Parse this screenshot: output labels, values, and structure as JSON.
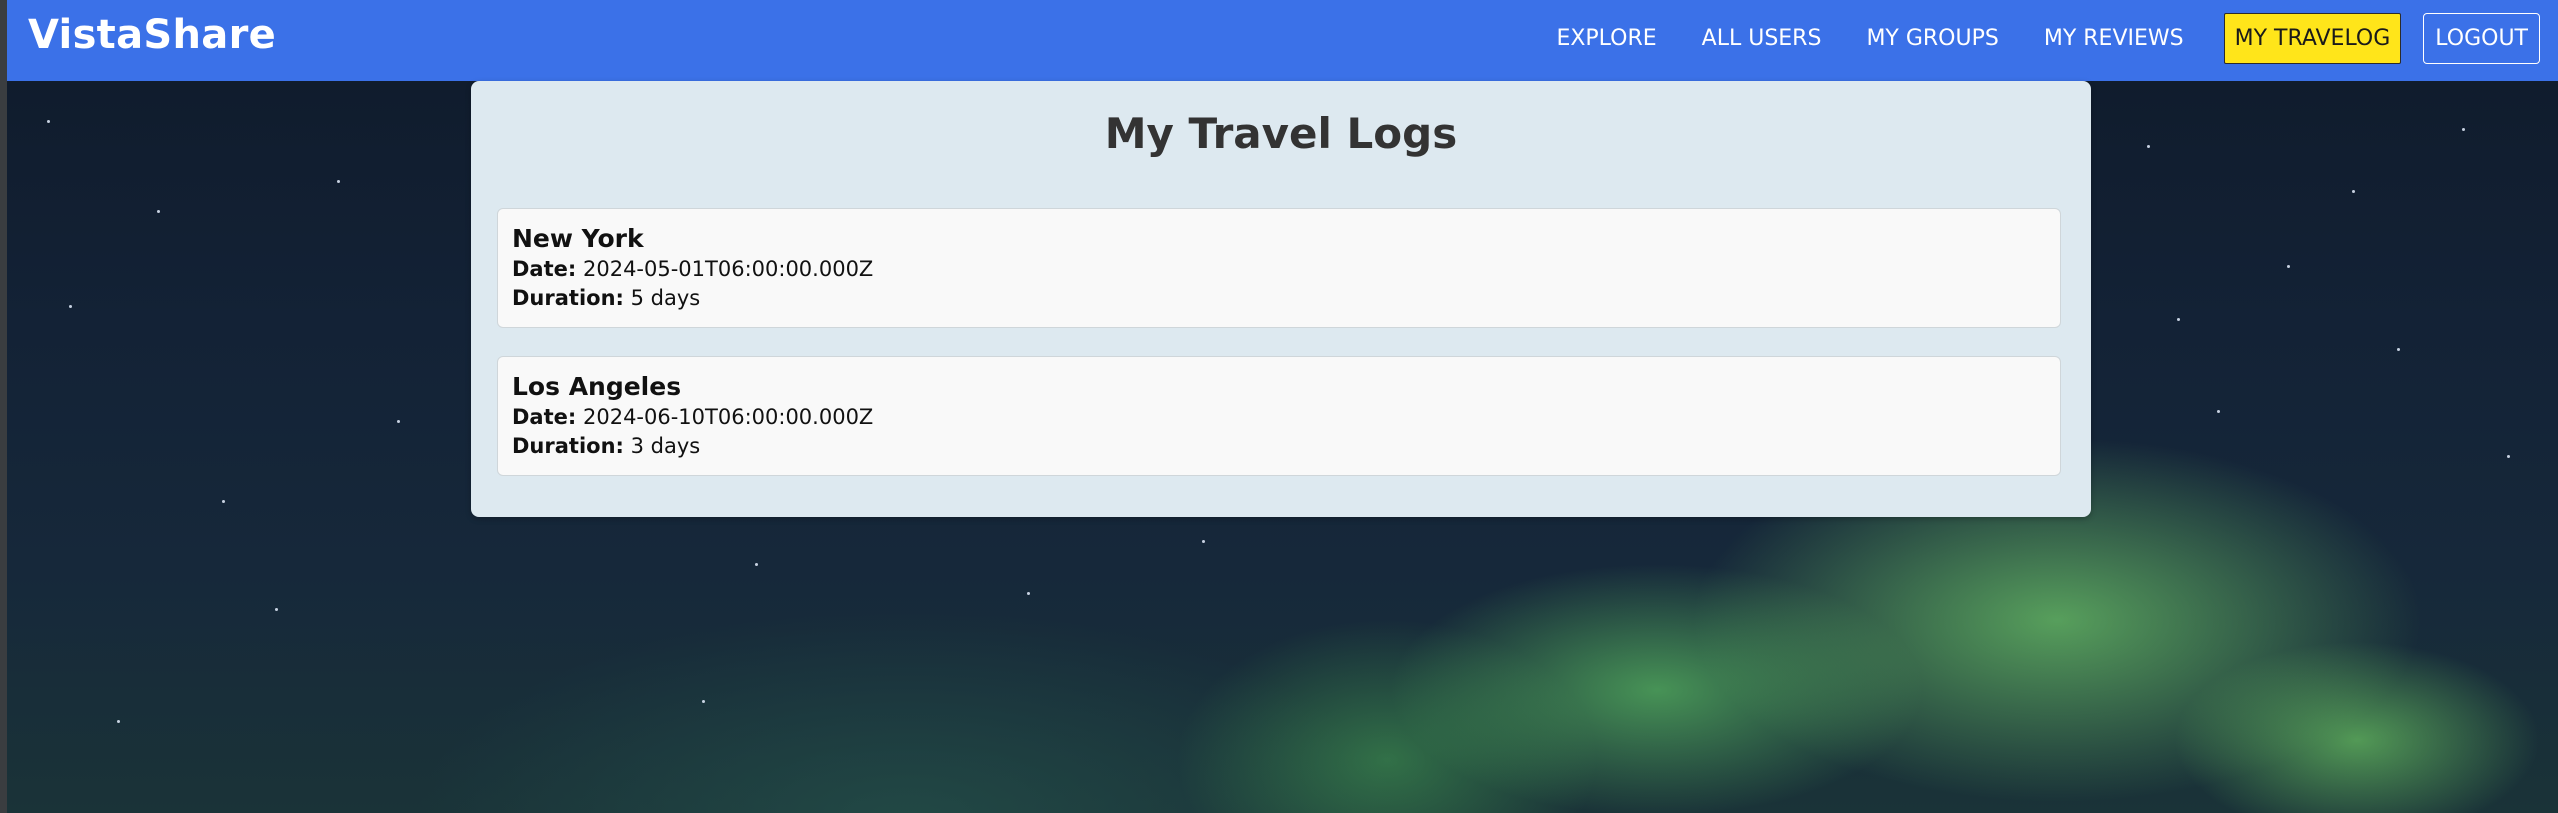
{
  "brand": "VistaShare",
  "nav": {
    "explore": "EXPLORE",
    "all_users": "ALL USERS",
    "my_groups": "MY GROUPS",
    "my_reviews": "MY REVIEWS",
    "my_travelog": "MY TRAVELOG",
    "logout": "LOGOUT"
  },
  "colors": {
    "navbar": "#3b71e8",
    "active_nav": "#ffe51a",
    "panel": "#dde9f0"
  },
  "page": {
    "title": "My Travel Logs",
    "date_label": "Date:",
    "duration_label": "Duration:",
    "logs": [
      {
        "city": "New York",
        "date": "2024-05-01T06:00:00.000Z",
        "duration": "5 days"
      },
      {
        "city": "Los Angeles",
        "date": "2024-06-10T06:00:00.000Z",
        "duration": "3 days"
      }
    ]
  }
}
